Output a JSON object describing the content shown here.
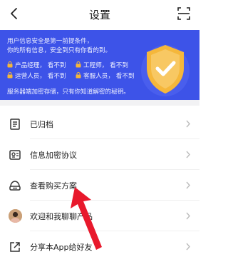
{
  "header": {
    "title": "设置"
  },
  "banner": {
    "line1": "用户信息安全是第一前提条件，",
    "line2": "你的所有信息，安全到只有你看的到。",
    "permissions": [
      {
        "role": "产品经理，",
        "status": "看不到"
      },
      {
        "role": "工程师，",
        "status": "看不到"
      },
      {
        "role": "运营人员，",
        "status": "看不到"
      },
      {
        "role": "客服人员，",
        "status": "看不到"
      }
    ],
    "footer": "服务器端加密存储，只有你知道解密的秘钥。"
  },
  "menu": [
    {
      "label": "已归档",
      "icon": "archive-icon"
    },
    {
      "label": "信息加密协议",
      "icon": "encryption-protocol-icon"
    },
    {
      "label": "查看购买方案",
      "icon": "purchase-plan-icon"
    },
    {
      "label": "欢迎和我聊聊产品",
      "icon": "avatar"
    },
    {
      "label": "分享本App给好友",
      "icon": "share-icon"
    }
  ],
  "colors": {
    "banner": "#3d53e8",
    "shield": "#f5b73b",
    "annotation_arrow": "#e8192c"
  }
}
